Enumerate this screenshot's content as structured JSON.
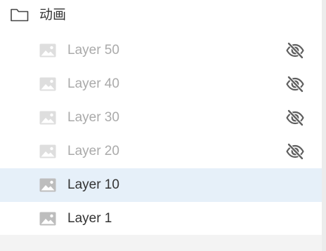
{
  "folder": {
    "label": "动画",
    "icon": "folder-icon"
  },
  "layers": [
    {
      "name": "Layer 50",
      "hidden": true,
      "selected": false,
      "icon": "image-icon",
      "visibility_icon": "eye-off-icon"
    },
    {
      "name": "Layer 40",
      "hidden": true,
      "selected": false,
      "icon": "image-icon",
      "visibility_icon": "eye-off-icon"
    },
    {
      "name": "Layer 30",
      "hidden": true,
      "selected": false,
      "icon": "image-icon",
      "visibility_icon": "eye-off-icon"
    },
    {
      "name": "Layer 20",
      "hidden": true,
      "selected": false,
      "icon": "image-icon",
      "visibility_icon": "eye-off-icon"
    },
    {
      "name": "Layer 10",
      "hidden": false,
      "selected": true,
      "icon": "image-icon"
    },
    {
      "name": "Layer 1",
      "hidden": false,
      "selected": false,
      "icon": "image-icon"
    }
  ],
  "colors": {
    "selected_row": "#e6f0f9",
    "text_normal": "#333333",
    "text_hidden": "#aaaaaa",
    "icon_hidden": "#5f5f5f"
  }
}
